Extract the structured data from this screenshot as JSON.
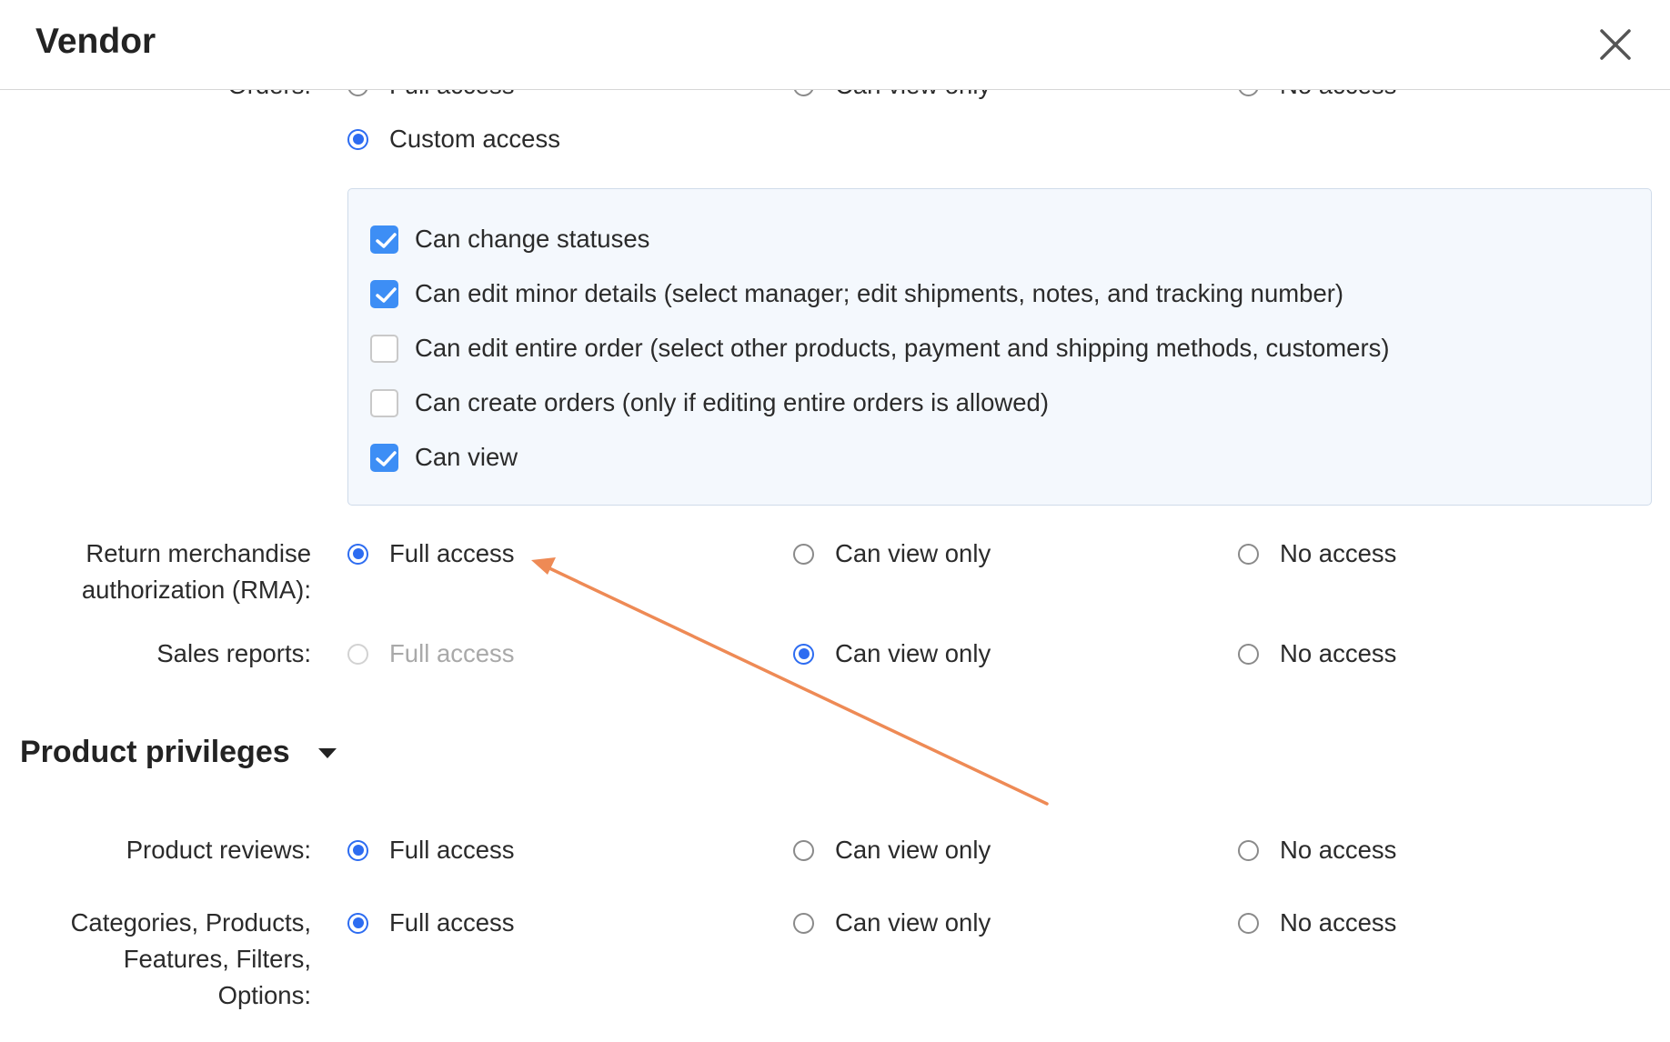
{
  "header": {
    "title": "Vendor"
  },
  "orders": {
    "label": "Orders:",
    "options": [
      "Full access",
      "Can view only",
      "No access"
    ],
    "custom_label": "Custom access"
  },
  "custom_permissions": [
    {
      "label": "Can change statuses",
      "checked": true
    },
    {
      "label": "Can edit minor details (select manager; edit shipments, notes, and tracking number)",
      "checked": true
    },
    {
      "label": "Can edit entire order (select other products, payment and shipping methods, customers)",
      "checked": false
    },
    {
      "label": "Can create orders (only if editing entire orders is allowed)",
      "checked": false
    },
    {
      "label": "Can view",
      "checked": true
    }
  ],
  "rma": {
    "label_line1": "Return merchandise",
    "label_line2": "authorization (RMA):",
    "full": "Full access",
    "view": "Can view only",
    "none": "No access",
    "selected": "full"
  },
  "sales_reports": {
    "label": "Sales reports:",
    "full": "Full access",
    "view": "Can view only",
    "none": "No access",
    "selected": "view"
  },
  "product_section": {
    "title": "Product privileges"
  },
  "product_reviews": {
    "label": "Product reviews:",
    "full": "Full access",
    "view": "Can view only",
    "none": "No access",
    "selected": "full"
  },
  "catalog": {
    "label_line1": "Categories, Products,",
    "label_line2": "Features, Filters,",
    "label_line3": "Options:",
    "full": "Full access",
    "view": "Can view only",
    "none": "No access",
    "selected": "full"
  },
  "colors": {
    "accent": "#2d6cf1",
    "checkbox": "#3d8ef5",
    "annotation_arrow": "#ee8a55"
  }
}
